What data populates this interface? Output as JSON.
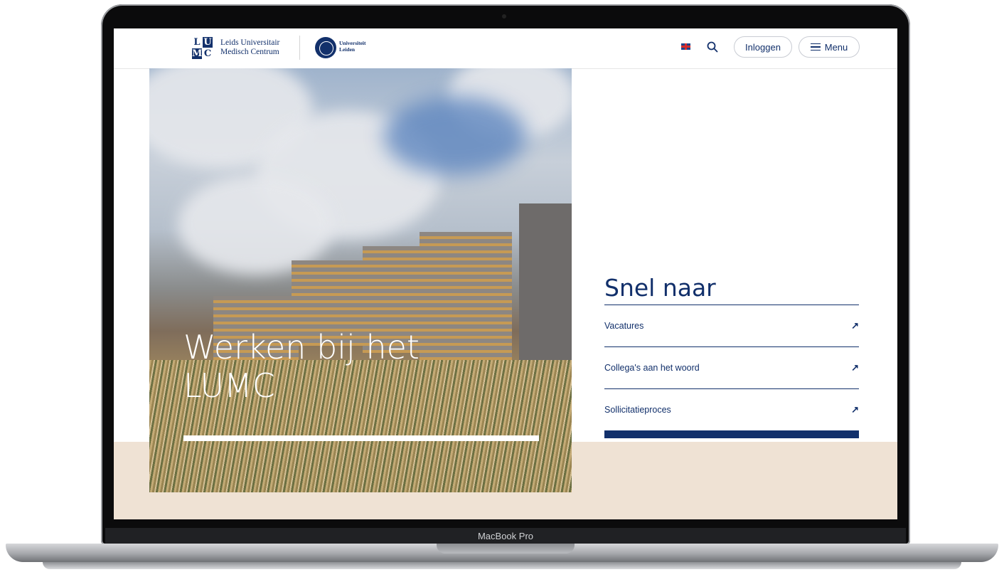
{
  "header": {
    "logo_letters": [
      "L",
      "U",
      "M",
      "C"
    ],
    "logo_name_line1": "Leids Universitair",
    "logo_name_line2": "Medisch Centrum",
    "uni_line1": "Universiteit",
    "uni_line2": "Leiden",
    "login_label": "Inloggen",
    "menu_label": "Menu"
  },
  "hero": {
    "title_line1": "Werken bij het",
    "title_line2": "LUMC"
  },
  "snel_naar": {
    "title": "Snel naar",
    "links": [
      {
        "label": "Vacatures",
        "icon": "↗"
      },
      {
        "label": "Collega's aan het woord",
        "icon": "↗"
      },
      {
        "label": "Sollicitatieproces",
        "icon": "↗"
      }
    ]
  },
  "device": {
    "label": "MacBook Pro"
  },
  "colors": {
    "brand": "#12306b",
    "beige": "#efe2d4"
  }
}
